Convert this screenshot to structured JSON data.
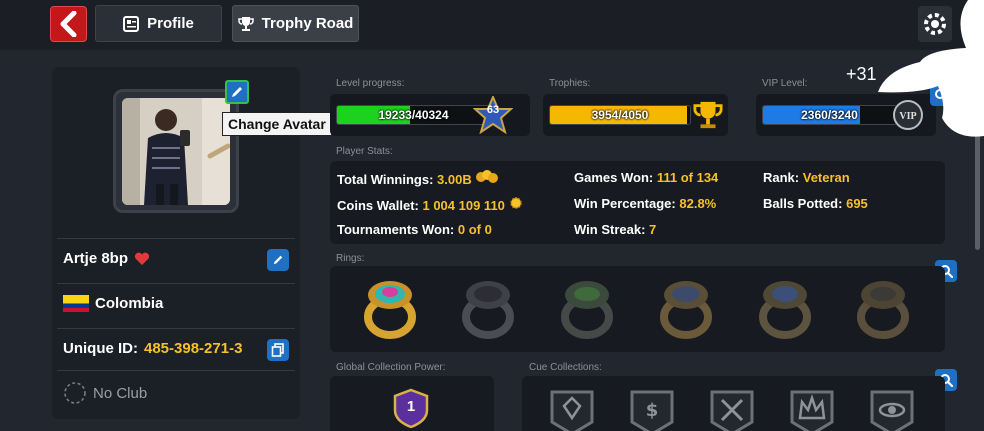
{
  "header": {
    "back_label": "",
    "tabs": [
      {
        "label": "Profile",
        "active": false
      },
      {
        "label": "Trophy Road",
        "active": true
      }
    ]
  },
  "profile": {
    "tooltip": "Change Avatar",
    "name": "Artje 8bp",
    "country": "Colombia",
    "unique_id_label": "Unique ID:",
    "unique_id_value": "485-398-271-3",
    "club": "No Club"
  },
  "progress": {
    "level": {
      "label": "Level progress:",
      "text": "19233/40324",
      "fraction": 0.477,
      "badge": "63",
      "color": "#1dd11f"
    },
    "trophies": {
      "label": "Trophies:",
      "text": "3954/4050",
      "fraction": 0.976,
      "color": "#f5b800"
    },
    "vip": {
      "label": "VIP Level:",
      "text": "2360/3240",
      "fraction": 0.728,
      "color": "#1f7ae6"
    }
  },
  "stats": {
    "label": "Player Stats:",
    "total_winnings_label": "Total Winnings:",
    "total_winnings_value": "3.00B",
    "coins_wallet_label": "Coins Wallet:",
    "coins_wallet_value": "1 004 109 110",
    "tournaments_won_label": "Tournaments Won:",
    "tournaments_won_value": "0 of 0",
    "games_won_label": "Games Won:",
    "games_won_value": "111 of 134",
    "win_pct_label": "Win Percentage:",
    "win_pct_value": "82.8%",
    "win_streak_label": "Win Streak:",
    "win_streak_value": "7",
    "rank_label": "Rank:",
    "rank_value": "Veteran",
    "balls_potted_label": "Balls Potted:",
    "balls_potted_value": "695"
  },
  "rings": {
    "label": "Rings:"
  },
  "collection": {
    "gcp_label": "Global Collection Power:",
    "gcp_value": "1",
    "cue_label": "Cue Collections:"
  },
  "overlay": {
    "text": "+31"
  },
  "colors": {
    "accent_yellow": "#f6c12c",
    "button_blue": "#1f6fc3",
    "back_red": "#c3171a"
  }
}
